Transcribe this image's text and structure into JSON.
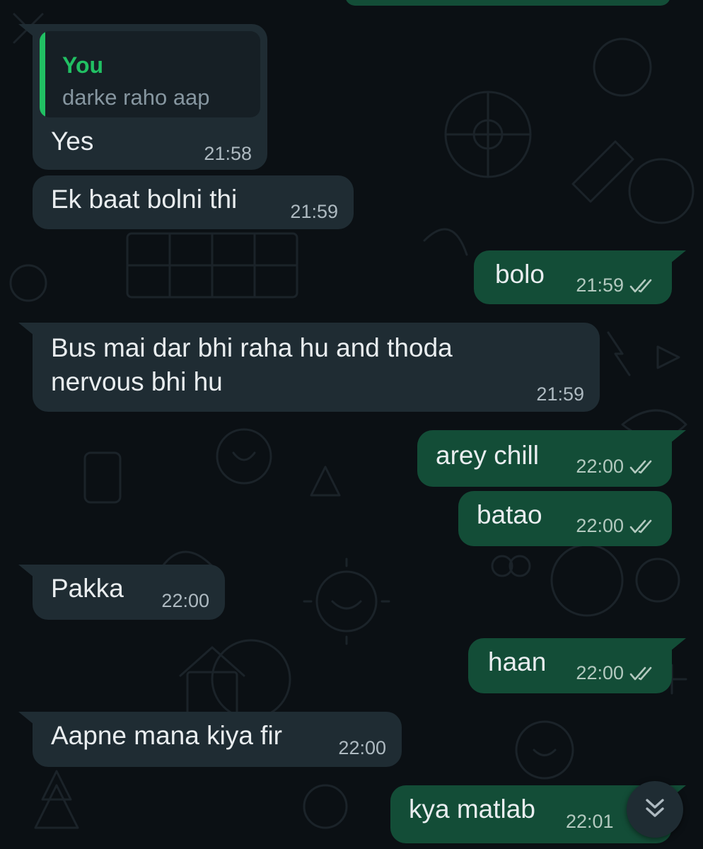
{
  "chat": {
    "background_color": "#0b1014",
    "incoming_color": "#1f2c33",
    "outgoing_color": "#134d37",
    "messages": [
      {
        "direction": "in",
        "text": "Yes",
        "time": "21:58",
        "reply": {
          "author": "You",
          "text": "darke raho aap"
        }
      },
      {
        "direction": "in",
        "text": "Ek baat bolni thi",
        "time": "21:59"
      },
      {
        "direction": "out",
        "text": "bolo",
        "time": "21:59",
        "status": "double-tick-icon"
      },
      {
        "direction": "in",
        "text": "Bus mai dar bhi raha hu and thoda nervous bhi hu",
        "time": "21:59"
      },
      {
        "direction": "out",
        "text": "arey chill",
        "time": "22:00",
        "status": "double-tick-icon"
      },
      {
        "direction": "out",
        "text": "batao",
        "time": "22:00",
        "status": "double-tick-icon"
      },
      {
        "direction": "in",
        "text": "Pakka",
        "time": "22:00"
      },
      {
        "direction": "out",
        "text": "haan",
        "time": "22:00",
        "status": "double-tick-icon"
      },
      {
        "direction": "in",
        "text": "Aapne mana kiya fir",
        "time": "22:00"
      },
      {
        "direction": "out",
        "text": "kya matlab",
        "time": "22:01",
        "status": "double-tick-icon"
      }
    ]
  },
  "scroll_button": {
    "icon": "double-chevron-down-icon"
  }
}
